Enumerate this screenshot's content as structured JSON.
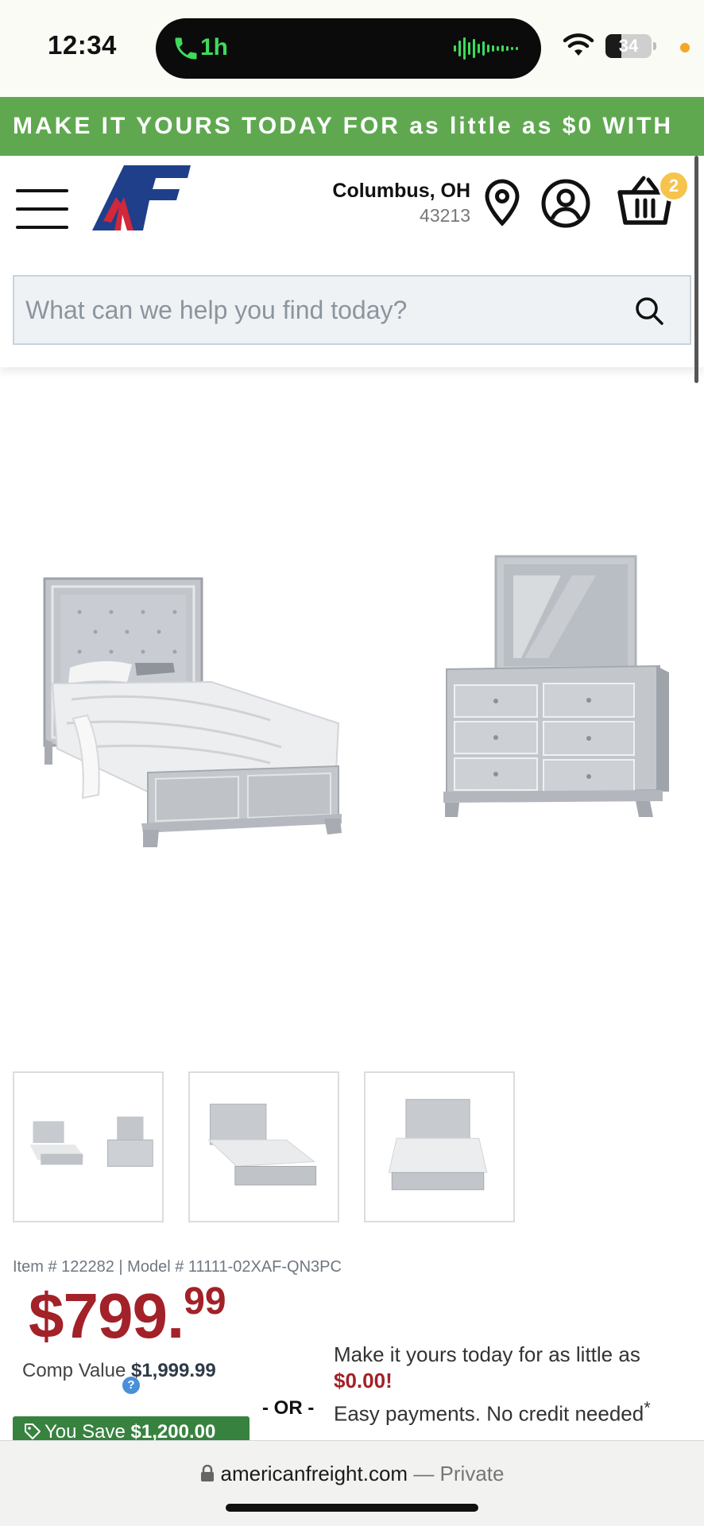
{
  "status_bar": {
    "time": "12:34",
    "call_duration": "1h",
    "battery_level": "34",
    "battery_fraction": 0.34
  },
  "promo_banner": {
    "text": "MAKE IT YOURS TODAY FOR as little as $0 WITH"
  },
  "header": {
    "location": {
      "city": "Columbus, OH",
      "zip": "43213"
    },
    "cart_count": "2",
    "search": {
      "placeholder": "What can we help you find today?",
      "value": ""
    },
    "colors": {
      "logo_blue": "#1f3f8a",
      "logo_red": "#d3273a"
    }
  },
  "product": {
    "item_line": "Item # 122282 | Model # 11111-02XAF-QN3PC",
    "price_dollars": "$799.",
    "price_cents": "99",
    "comp_label": "Comp Value",
    "comp_value": "$1,999.99",
    "help_icon": "?",
    "or_label": "- OR -",
    "financing_line1": "Make it yours today for as little as",
    "financing_amount": "$0.00!",
    "financing_line2": "Easy payments. No credit needed",
    "financing_asterisk": "*",
    "you_save_label": "You Save",
    "you_save_amount": "$1,200.00",
    "thumbnails": [
      "bed-and-dresser-thumbnail",
      "bed-angle-thumbnail",
      "bed-front-thumbnail"
    ],
    "colors": {
      "price": "#a32128",
      "save_badge": "#37823f",
      "promo": "#5fa850"
    }
  },
  "browser": {
    "domain": "americanfreight.com",
    "mode": "— Private"
  }
}
